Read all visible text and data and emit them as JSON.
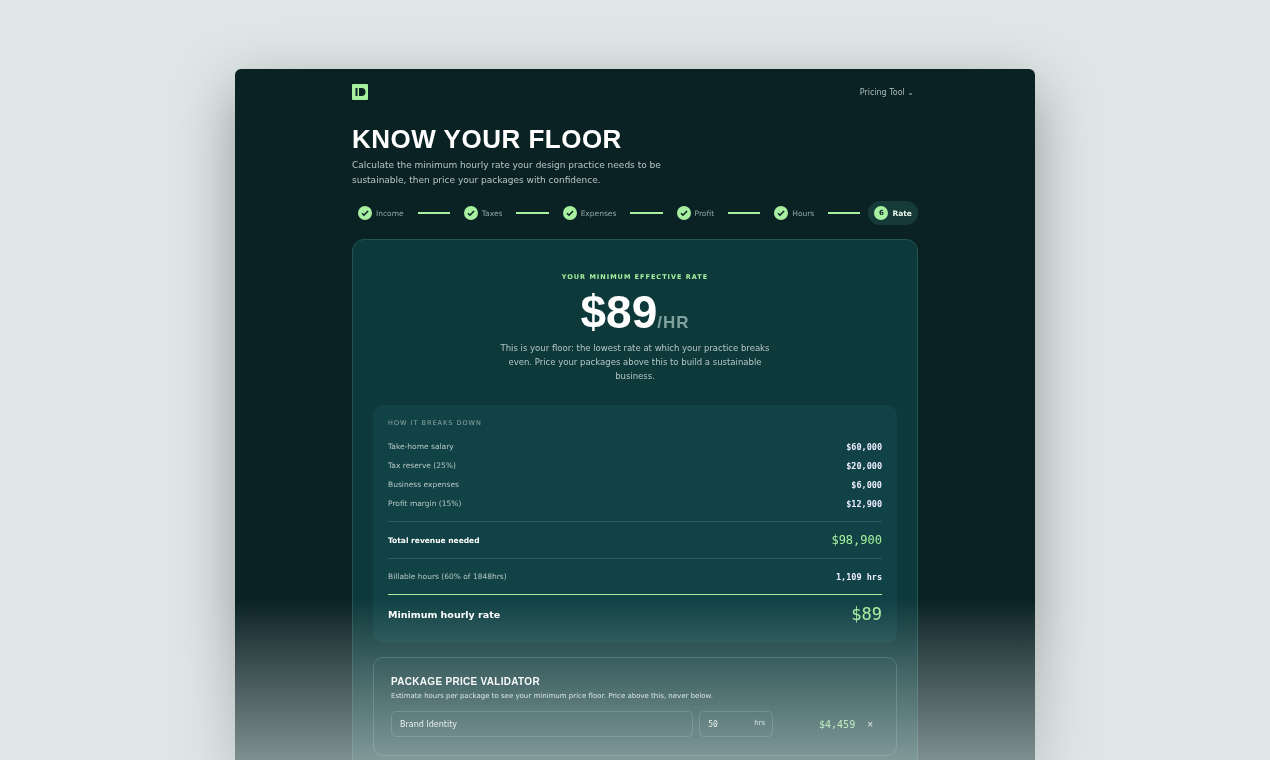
{
  "nav": {
    "menu": "Pricing Tool",
    "caret": "⌄"
  },
  "hero": {
    "title": "KNOW YOUR FLOOR",
    "subtitle": "Calculate the minimum hourly rate your design practice needs to be sustainable, then price your packages with confidence."
  },
  "steps": [
    {
      "label": "Income",
      "kind": "done",
      "selected": false
    },
    {
      "label": "Taxes",
      "kind": "done",
      "selected": false
    },
    {
      "label": "Expenses",
      "kind": "done",
      "selected": false
    },
    {
      "label": "Profit",
      "kind": "done",
      "selected": false
    },
    {
      "label": "Hours",
      "kind": "done",
      "selected": false
    },
    {
      "label": "Rate",
      "kind": "current",
      "number": "6",
      "selected": true
    }
  ],
  "result": {
    "eyebrow": "YOUR MINIMUM EFFECTIVE RATE",
    "rate": "$89",
    "unit": "/HR",
    "description": "This is your floor: the lowest rate at which your practice breaks even. Price your packages above this to build a sustainable business."
  },
  "breakdown": {
    "heading": "HOW IT BREAKS DOWN",
    "rows": [
      {
        "label": "Take-home salary",
        "value": "$60,000",
        "kind": "item"
      },
      {
        "label": "Tax reserve (25%)",
        "value": "$20,000",
        "kind": "item"
      },
      {
        "label": "Business expenses",
        "value": "$6,000",
        "kind": "item"
      },
      {
        "label": "Profit margin (15%)",
        "value": "$12,900",
        "kind": "item"
      },
      {
        "label": "Total revenue needed",
        "value": "$98,900",
        "kind": "total"
      },
      {
        "label": "Billable hours (60% of 1848hrs)",
        "value": "1,109 hrs",
        "kind": "hours"
      },
      {
        "label": "Minimum hourly rate",
        "value": "$89",
        "kind": "final"
      }
    ]
  },
  "validator": {
    "title": "PACKAGE PRICE VALIDATOR",
    "hint": "Estimate hours per package to see your minimum price floor. Price above this, never below.",
    "packages": [
      {
        "name": "Brand Identity",
        "hours": "50",
        "unit": "hrs",
        "price": "$4,459",
        "remove": "×"
      }
    ]
  }
}
